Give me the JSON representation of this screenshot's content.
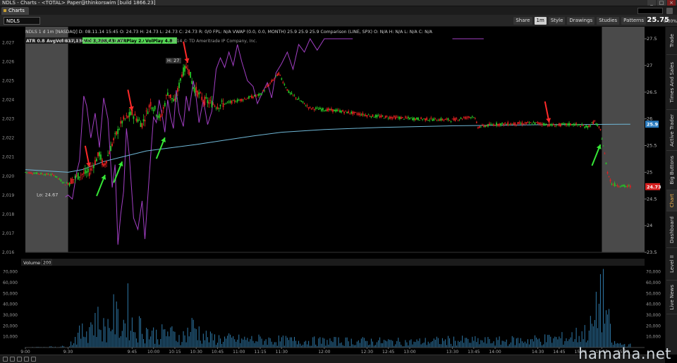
{
  "window": {
    "title": "NDLS - Charts - <TOTAL> Paper@thinkorswim [build 1866.23]"
  },
  "tab": {
    "label": "Charts"
  },
  "symbol": {
    "value": "NDLS"
  },
  "toolbar": {
    "share": "Share",
    "timeframe": "1m",
    "style": "Style",
    "drawings": "Drawings",
    "studies": "Studies",
    "patterns": "Patterns"
  },
  "quote": {
    "last": "25.75",
    "pct_change": "0.00%"
  },
  "header": {
    "line": "NDLS 1 d 1m [NASDAQ]  D: 08.11.14 15:45  O: 24.73  H: 24.73  L: 24.73  C: 24.73  R: 0/0  FPL: N/A  VWAP (0.0, 0.0, MONTH)  25.9  25.9  25.9  Comparison (LINE, SPX)  O: N/A  H: N/A  L: N/A  C: N/A",
    "atr": "ATR 0.88",
    "avgvol": "AvgVol 617,136",
    "vol": "Vol 3,298,438",
    "atrplay": "ATRPlay 2.6",
    "volplay": "VolPlay 4.8",
    "company": "NOODLES & CO CLASS A COM",
    "copyright": "2014 © TD Ameritrade IP Company, Inc."
  },
  "volume_label": "Volume",
  "volume_value": "200",
  "annotations": {
    "low": "Lo: 24.67",
    "high": "H: 27"
  },
  "side_tabs": [
    "Trade",
    "Times And Sales",
    "Active Trader",
    "Big Buttons",
    "Chart",
    "Dashboard",
    "Level II",
    "Live News"
  ],
  "side_active": "Chart",
  "watermark": "hamaha.net",
  "colors": {
    "up": "#26c426",
    "down": "#e02020",
    "comparison": "#a23fc4",
    "vwap": "#6fb7d6",
    "volume": "#2f79a8",
    "arrow_red": "#ff2a2a",
    "arrow_green": "#36e636",
    "last_badge": "#d62020",
    "vwap_badge": "#2a7bbf"
  },
  "chart_data": {
    "type": "candlestick",
    "price_axis": {
      "range": [
        23.5,
        27.5
      ],
      "ticks": [
        "27.5",
        "27",
        "26.5",
        "26",
        "25.5",
        "25",
        "24.5",
        "24",
        "23.5"
      ],
      "last_label": "24.73",
      "vwap_label": "25.9"
    },
    "comparison_axis": {
      "range": [
        2016,
        2027.2
      ],
      "ticks": [
        "2,027",
        "2,026",
        "2,025",
        "2,024",
        "2,023",
        "2,022",
        "2,021",
        "2,020",
        "2,019",
        "2,018",
        "2,017",
        "2,016"
      ]
    },
    "volume_axis": {
      "range": [
        0,
        75000
      ],
      "ticks": [
        "70,000",
        "60,000",
        "50,000",
        "40,000",
        "30,000",
        "20,000",
        "10,000"
      ]
    },
    "time_axis": {
      "range_min": [
        0,
        435
      ],
      "labels": [
        {
          "t": 0,
          "label": "9:00"
        },
        {
          "t": 30,
          "label": "9:30"
        },
        {
          "t": 75,
          "label": "9:45"
        },
        {
          "t": 90,
          "label": "10:00"
        },
        {
          "t": 105,
          "label": "10:15"
        },
        {
          "t": 120,
          "label": "10:30"
        },
        {
          "t": 135,
          "label": "10:45"
        },
        {
          "t": 150,
          "label": "11:00"
        },
        {
          "t": 165,
          "label": "11:15"
        },
        {
          "t": 180,
          "label": "11:30"
        },
        {
          "t": 210,
          "label": "12:00"
        },
        {
          "t": 240,
          "label": "12:30"
        },
        {
          "t": 255,
          "label": "12:45"
        },
        {
          "t": 270,
          "label": "13:00"
        },
        {
          "t": 300,
          "label": "13:30"
        },
        {
          "t": 315,
          "label": "13:45"
        },
        {
          "t": 330,
          "label": "14:00"
        },
        {
          "t": 360,
          "label": "14:30"
        },
        {
          "t": 375,
          "label": "14:45"
        },
        {
          "t": 390,
          "label": "15:00"
        },
        {
          "t": 405,
          "label": "15:15"
        },
        {
          "t": 420,
          "label": "15:30"
        }
      ]
    },
    "sessions": {
      "premarket_end": 30,
      "postmarket_start": 405
    },
    "price_path": [
      [
        0,
        25.0
      ],
      [
        20,
        24.95
      ],
      [
        28,
        24.78
      ],
      [
        30,
        24.8
      ],
      [
        38,
        24.95
      ],
      [
        45,
        25.0
      ],
      [
        52,
        25.35
      ],
      [
        55,
        25.1
      ],
      [
        62,
        25.6
      ],
      [
        68,
        25.95
      ],
      [
        75,
        26.1
      ],
      [
        82,
        25.9
      ],
      [
        88,
        26.3
      ],
      [
        95,
        26.0
      ],
      [
        100,
        26.5
      ],
      [
        105,
        26.3
      ],
      [
        110,
        26.85
      ],
      [
        114,
        27.0
      ],
      [
        118,
        26.6
      ],
      [
        125,
        26.35
      ],
      [
        135,
        26.25
      ],
      [
        150,
        26.35
      ],
      [
        165,
        26.45
      ],
      [
        178,
        26.85
      ],
      [
        185,
        26.5
      ],
      [
        200,
        26.2
      ],
      [
        220,
        26.15
      ],
      [
        245,
        26.05
      ],
      [
        275,
        26.0
      ],
      [
        300,
        25.98
      ],
      [
        315,
        26.05
      ],
      [
        318,
        25.85
      ],
      [
        330,
        25.9
      ],
      [
        360,
        25.92
      ],
      [
        370,
        25.88
      ],
      [
        385,
        25.9
      ],
      [
        395,
        25.85
      ],
      [
        400,
        25.95
      ],
      [
        404,
        25.78
      ],
      [
        406,
        25.5
      ],
      [
        409,
        25.0
      ],
      [
        412,
        24.78
      ],
      [
        420,
        24.74
      ],
      [
        425,
        24.73
      ]
    ],
    "vwap_path": [
      [
        0,
        25.05
      ],
      [
        30,
        25.0
      ],
      [
        40,
        25.05
      ],
      [
        55,
        25.2
      ],
      [
        70,
        25.3
      ],
      [
        85,
        25.4
      ],
      [
        100,
        25.45
      ],
      [
        120,
        25.52
      ],
      [
        140,
        25.6
      ],
      [
        160,
        25.68
      ],
      [
        180,
        25.75
      ],
      [
        210,
        25.8
      ],
      [
        250,
        25.84
      ],
      [
        300,
        25.87
      ],
      [
        360,
        25.89
      ],
      [
        420,
        25.9
      ],
      [
        425,
        25.9
      ]
    ],
    "comparison_path": [
      [
        28,
        2018.9
      ],
      [
        30,
        2019.0
      ],
      [
        33,
        2018.8
      ],
      [
        36,
        2020.2
      ],
      [
        38,
        2020.8
      ],
      [
        41,
        2024.2
      ],
      [
        43,
        2023.7
      ],
      [
        46,
        2022.0
      ],
      [
        49,
        2023.3
      ],
      [
        52,
        2021.5
      ],
      [
        55,
        2024.1
      ],
      [
        58,
        2023.0
      ],
      [
        61,
        2019.4
      ],
      [
        63,
        2020.6
      ],
      [
        65,
        2016.4
      ],
      [
        67,
        2018.0
      ],
      [
        69,
        2019.2
      ],
      [
        71,
        2022.5
      ],
      [
        73,
        2021.1
      ],
      [
        76,
        2017.8
      ],
      [
        79,
        2017.2
      ],
      [
        82,
        2018.7
      ],
      [
        84,
        2016.7
      ],
      [
        87,
        2020.0
      ],
      [
        90,
        2023.1
      ],
      [
        92,
        2022.8
      ],
      [
        94,
        2024.0
      ],
      [
        96,
        2023.2
      ],
      [
        98,
        2022.3
      ],
      [
        100,
        2024.0
      ],
      [
        102,
        2023.1
      ],
      [
        104,
        2022.5
      ],
      [
        106,
        2024.5
      ],
      [
        108,
        2023.3
      ],
      [
        111,
        2022.6
      ],
      [
        113,
        2024.2
      ],
      [
        115,
        2023.4
      ],
      [
        118,
        2025.0
      ],
      [
        120,
        2024.1
      ],
      [
        122,
        2022.8
      ],
      [
        125,
        2024.0
      ],
      [
        128,
        2022.7
      ],
      [
        131,
        2023.4
      ],
      [
        134,
        2025.6
      ],
      [
        137,
        2026.2
      ],
      [
        140,
        2025.7
      ],
      [
        143,
        2026.5
      ],
      [
        146,
        2025.8
      ],
      [
        149,
        2026.9
      ],
      [
        152,
        2026.0
      ],
      [
        156,
        2025.0
      ],
      [
        160,
        2024.7
      ],
      [
        163,
        2023.8
      ],
      [
        166,
        2024.3
      ],
      [
        170,
        2024.9
      ],
      [
        173,
        2024.1
      ],
      [
        176,
        2025.4
      ],
      [
        180,
        2025.9
      ],
      [
        184,
        2026.5
      ],
      [
        188,
        2025.6
      ],
      [
        192,
        2026.9
      ],
      [
        196,
        2026.5
      ],
      [
        200,
        2027.4
      ],
      [
        205,
        2026.6
      ],
      [
        210,
        2027.3
      ],
      [
        216,
        2027.9
      ],
      [
        222,
        2027.5
      ],
      [
        230,
        2028.2
      ]
    ],
    "comparison_path_late": [
      [
        300,
        2027.3
      ],
      [
        308,
        2027.9
      ],
      [
        315,
        2027.4
      ],
      [
        322,
        2027.8
      ]
    ],
    "volume_profile": [
      [
        0,
        300
      ],
      [
        30,
        1500
      ],
      [
        36,
        14000
      ],
      [
        42,
        21000
      ],
      [
        45,
        30000
      ],
      [
        50,
        35000
      ],
      [
        56,
        22000
      ],
      [
        62,
        40000
      ],
      [
        68,
        26000
      ],
      [
        72,
        48000
      ],
      [
        76,
        24000
      ],
      [
        82,
        27000
      ],
      [
        88,
        18000
      ],
      [
        94,
        16000
      ],
      [
        100,
        20000
      ],
      [
        106,
        14000
      ],
      [
        112,
        15000
      ],
      [
        118,
        28000
      ],
      [
        124,
        16000
      ],
      [
        130,
        12000
      ],
      [
        140,
        11000
      ],
      [
        150,
        10000
      ],
      [
        165,
        10000
      ],
      [
        180,
        9000
      ],
      [
        210,
        8000
      ],
      [
        240,
        8000
      ],
      [
        270,
        7000
      ],
      [
        300,
        9000
      ],
      [
        330,
        8000
      ],
      [
        360,
        10000
      ],
      [
        380,
        12000
      ],
      [
        395,
        20000
      ],
      [
        400,
        32000
      ],
      [
        404,
        72000
      ],
      [
        406,
        60000
      ],
      [
        409,
        42000
      ],
      [
        412,
        6000
      ],
      [
        420,
        4000
      ],
      [
        425,
        3000
      ]
    ],
    "arrows_red": [
      {
        "t": 45,
        "p": 25.1
      },
      {
        "t": 75,
        "p": 26.15
      },
      {
        "t": 114,
        "p": 27.05
      },
      {
        "t": 368,
        "p": 25.93
      }
    ],
    "arrows_green": [
      {
        "t": 56,
        "p": 24.95
      },
      {
        "t": 68,
        "p": 25.2
      },
      {
        "t": 98,
        "p": 25.65
      },
      {
        "t": 404,
        "p": 25.52
      }
    ]
  }
}
